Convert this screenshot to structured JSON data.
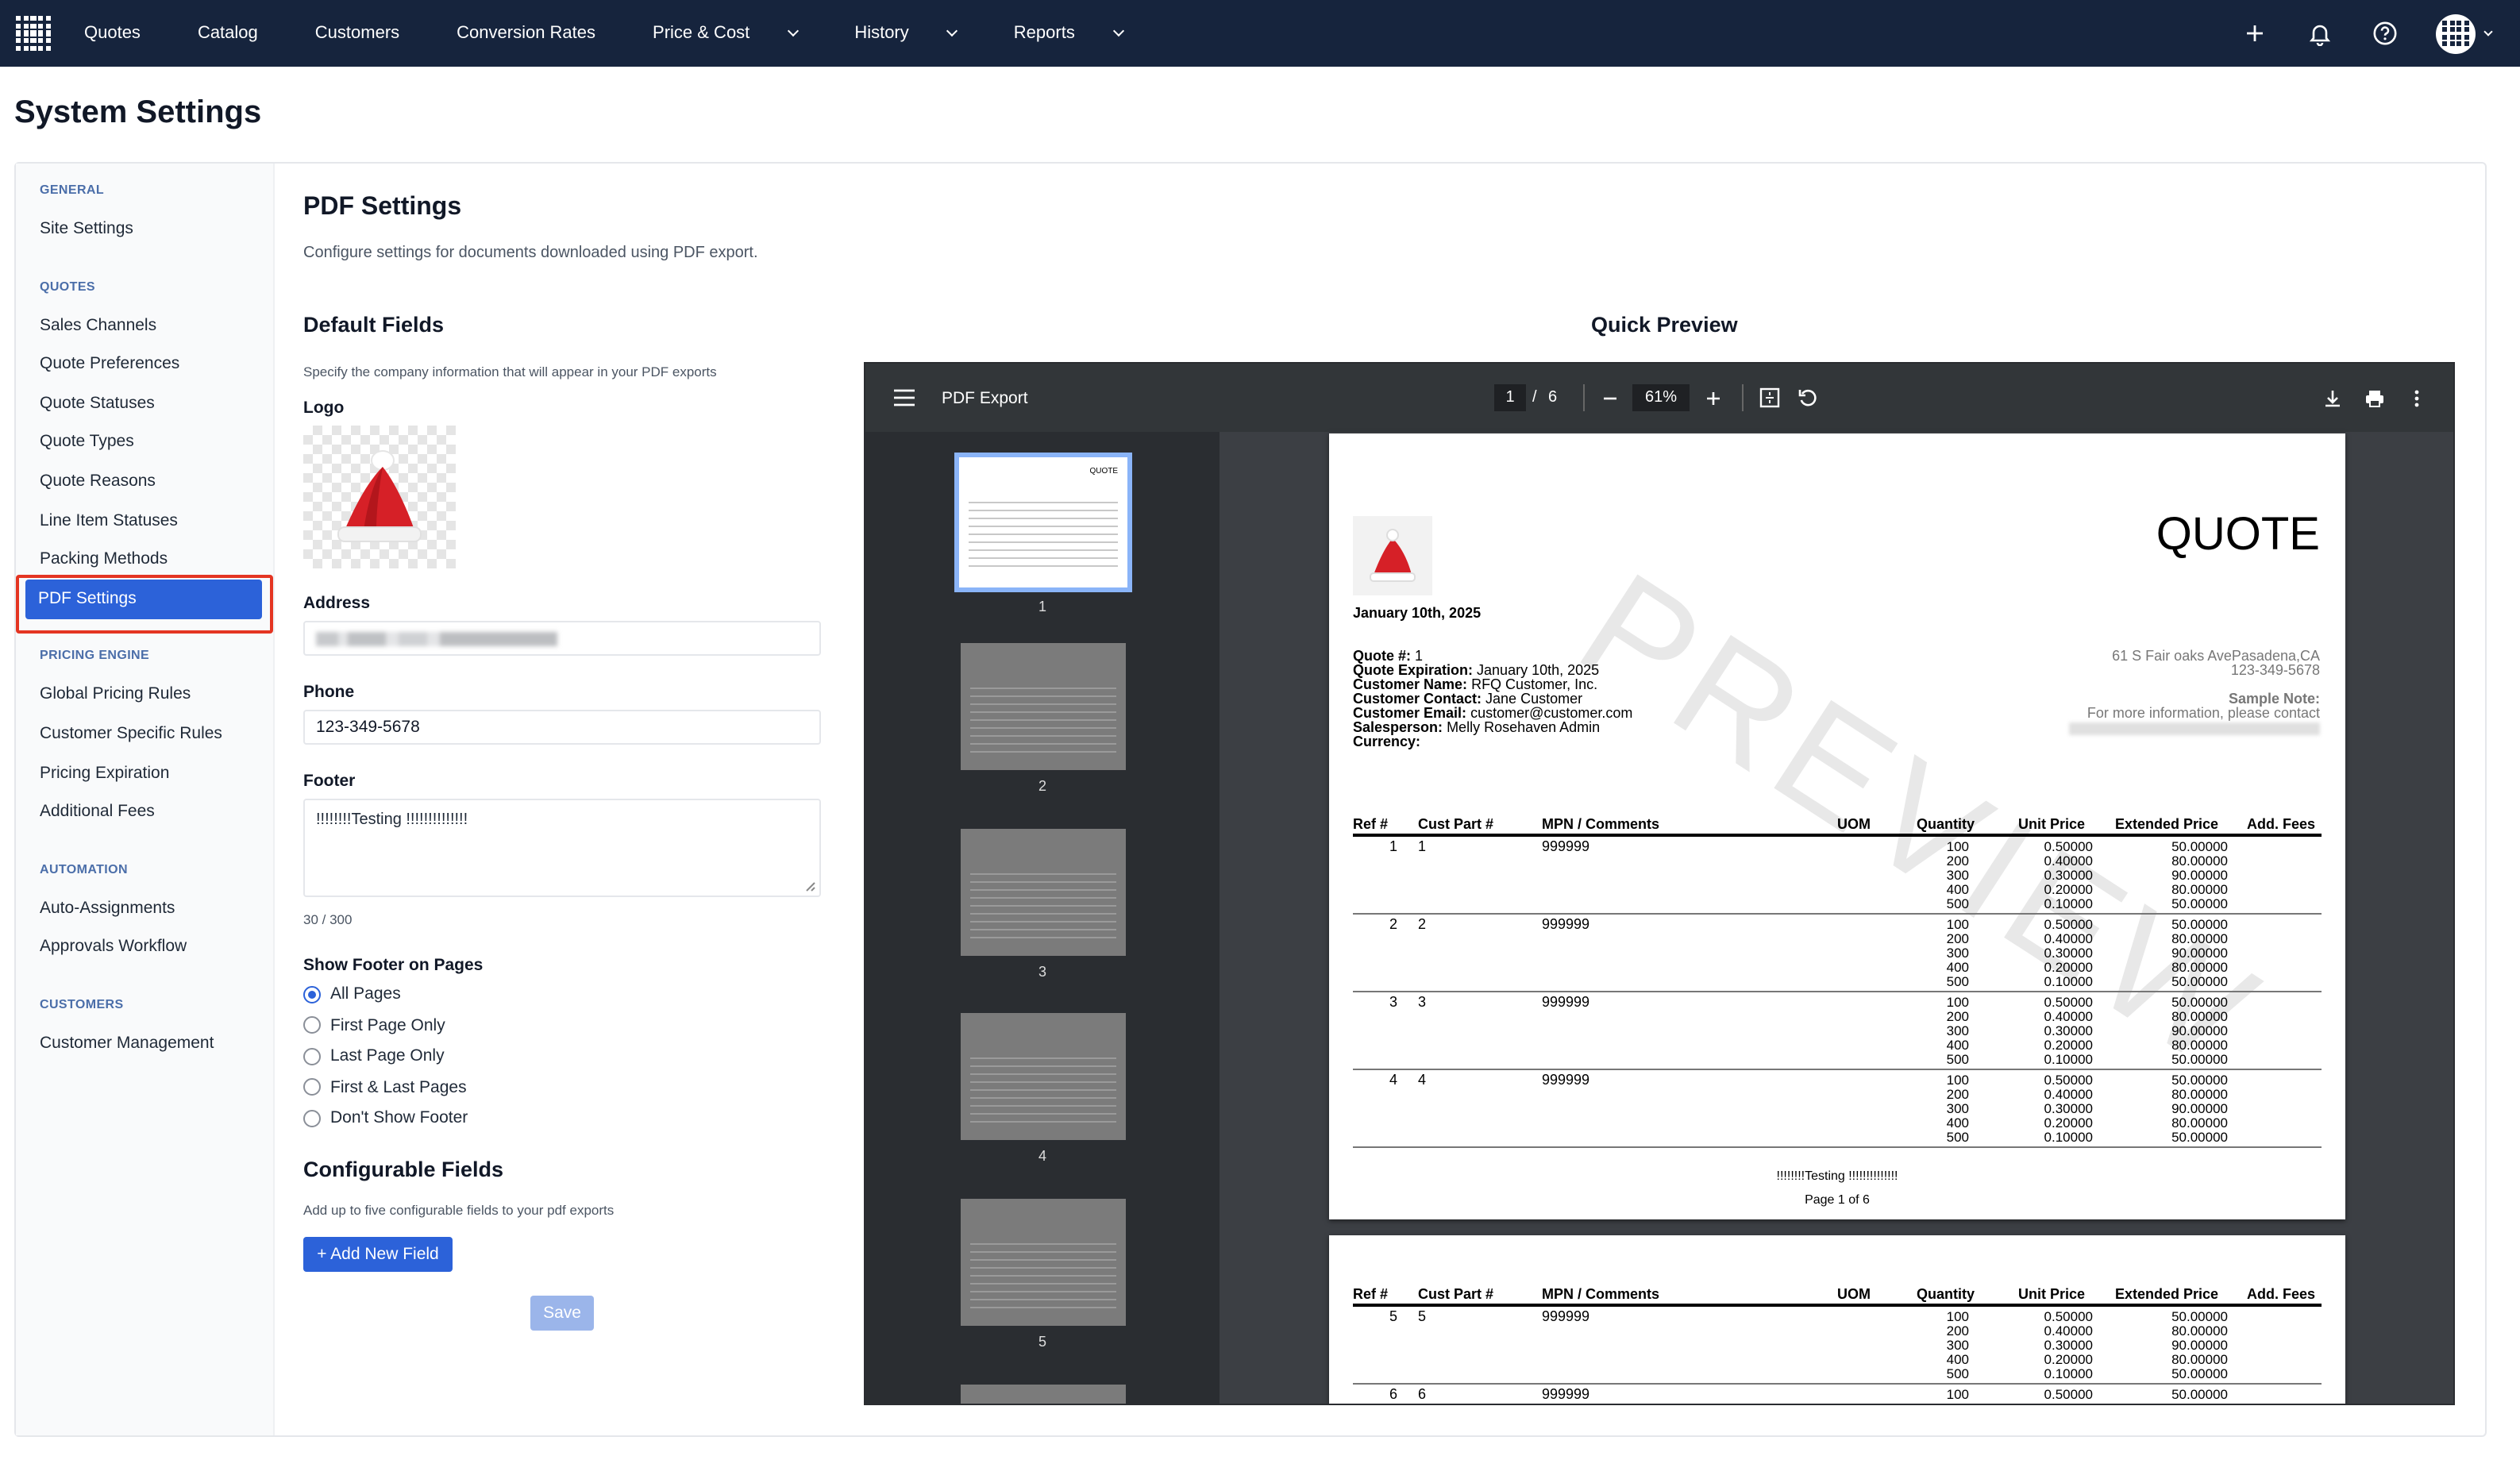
{
  "nav": {
    "links": [
      "Quotes",
      "Catalog",
      "Customers",
      "Conversion Rates",
      "Price & Cost",
      "History",
      "Reports"
    ],
    "dropdown_flags": [
      false,
      false,
      false,
      false,
      true,
      true,
      true
    ]
  },
  "page": {
    "title": "System Settings"
  },
  "sidebar": {
    "sections": [
      {
        "label": "GENERAL",
        "items": [
          "Site Settings"
        ]
      },
      {
        "label": "QUOTES",
        "items": [
          "Sales Channels",
          "Quote Preferences",
          "Quote Statuses",
          "Quote Types",
          "Quote Reasons",
          "Line Item Statuses",
          "Packing Methods",
          "PDF Settings"
        ]
      },
      {
        "label": "PRICING ENGINE",
        "items": [
          "Global Pricing Rules",
          "Customer Specific Rules",
          "Pricing Expiration",
          "Additional Fees"
        ]
      },
      {
        "label": "AUTOMATION",
        "items": [
          "Auto-Assignments",
          "Approvals Workflow"
        ]
      },
      {
        "label": "CUSTOMERS",
        "items": [
          "Customer Management"
        ]
      }
    ],
    "active": "PDF Settings"
  },
  "pdf_settings": {
    "title": "PDF Settings",
    "description": "Configure settings for documents downloaded using PDF export.",
    "default_fields_title": "Default Fields",
    "default_fields_desc": "Specify the company information that will appear in your PDF exports",
    "logo_label": "Logo",
    "address_label": "Address",
    "phone_label": "Phone",
    "phone_value": "123-349-5678",
    "footer_label": "Footer",
    "footer_value": "!!!!!!!!Testing !!!!!!!!!!!!!!",
    "footer_count": "30 / 300",
    "show_footer_label": "Show Footer on Pages",
    "footer_options": [
      "All Pages",
      "First Page Only",
      "Last Page Only",
      "First & Last Pages",
      "Don't Show Footer"
    ],
    "footer_selected": "All Pages",
    "configurable_title": "Configurable Fields",
    "configurable_desc": "Add up to five configurable fields to your pdf exports",
    "add_field_button": "+ Add New Field",
    "save_button": "Save"
  },
  "preview": {
    "title": "Quick Preview",
    "viewer_title": "PDF Export",
    "page_current": "1",
    "page_sep": "/",
    "page_total": "6",
    "zoom": "61%",
    "thumb_numbers": [
      "1",
      "2",
      "3",
      "4",
      "5"
    ]
  },
  "quote_doc": {
    "heading": "QUOTE",
    "date": "January 10th, 2025",
    "watermark": "PREVIEW",
    "fields": [
      {
        "k": "Quote #:",
        "v": " 1"
      },
      {
        "k": "Quote Expiration:",
        "v": " January 10th, 2025"
      },
      {
        "k": "Customer Name:",
        "v": " RFQ Customer, Inc."
      },
      {
        "k": "Customer Contact:",
        "v": " Jane Customer"
      },
      {
        "k": "Customer Email:",
        "v": " customer@customer.com"
      },
      {
        "k": "Salesperson:",
        "v": " Melly Rosehaven Admin"
      },
      {
        "k": "Currency:",
        "v": ""
      }
    ],
    "address_line1": "61 S Fair oaks AvePasadena,CA",
    "address_line2": "123-349-5678",
    "sample_note_label": "Sample Note:",
    "sample_note_text": "For more information, please contact",
    "columns": [
      "Ref #",
      "Cust Part #",
      "MPN / Comments",
      "UOM",
      "Quantity",
      "Unit Price",
      "Extended Price",
      "Add. Fees"
    ],
    "quantities": [
      "100",
      "200",
      "300",
      "400",
      "500"
    ],
    "unit_prices": [
      "0.50000",
      "0.40000",
      "0.30000",
      "0.20000",
      "0.10000"
    ],
    "extended_prices": [
      "50.00000",
      "80.00000",
      "90.00000",
      "80.00000",
      "50.00000"
    ],
    "rows_page1": [
      {
        "ref": "1",
        "cust": "1",
        "mpn": "999999"
      },
      {
        "ref": "2",
        "cust": "2",
        "mpn": "999999"
      },
      {
        "ref": "3",
        "cust": "3",
        "mpn": "999999"
      },
      {
        "ref": "4",
        "cust": "4",
        "mpn": "999999"
      }
    ],
    "rows_page2": [
      {
        "ref": "5",
        "cust": "5",
        "mpn": "999999"
      },
      {
        "ref": "6",
        "cust": "6",
        "mpn": "999999"
      }
    ],
    "footer_text": "!!!!!!!!Testing !!!!!!!!!!!!!!",
    "page_label": "Page 1 of 6"
  }
}
